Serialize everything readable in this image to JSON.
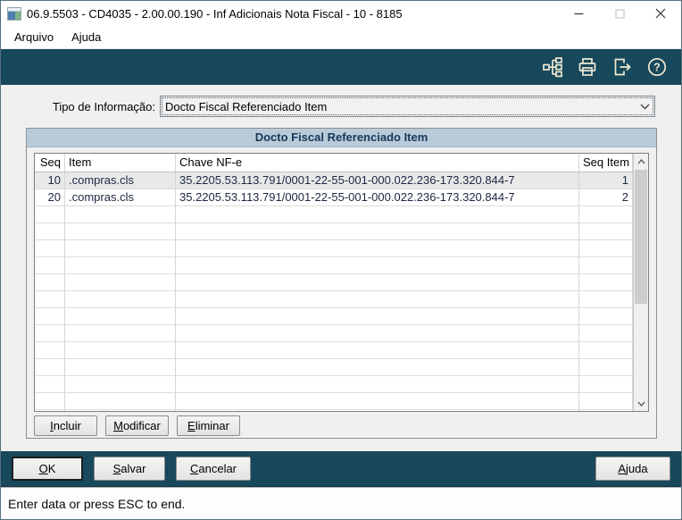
{
  "window": {
    "title": "06.9.5503 - CD4035 - 2.00.00.190 - Inf Adicionais Nota Fiscal - 10 - 8185",
    "controls": [
      {
        "name": "minimize",
        "disabled": false
      },
      {
        "name": "maximize",
        "disabled": true
      },
      {
        "name": "close",
        "disabled": false
      }
    ]
  },
  "menu": {
    "items": [
      {
        "label": "Arquivo"
      },
      {
        "label": "Ajuda"
      }
    ]
  },
  "toolbar": {
    "icons": [
      {
        "name": "program-tree-icon"
      },
      {
        "name": "print-icon"
      },
      {
        "name": "exit-icon"
      },
      {
        "name": "help-icon"
      }
    ]
  },
  "form": {
    "tipo_label": "Tipo de Informação:",
    "tipo_value": "Docto Fiscal Referenciado Item",
    "group_title": "Docto Fiscal Referenciado Item",
    "table": {
      "columns": [
        "Seq",
        "Item",
        "Chave NF-e",
        "Seq Item"
      ],
      "rows": [
        {
          "seq": "10",
          "item": ".compras.cls",
          "chave": "35.2205.53.113.791/0001-22-55-001-000.022.236-173.320.844-7",
          "seq_item": "1"
        },
        {
          "seq": "20",
          "item": ".compras.cls",
          "chave": "35.2205.53.113.791/0001-22-55-001-000.022.236-173.320.844-7",
          "seq_item": "2"
        }
      ],
      "selected_row_index": 0,
      "visible_row_count": 15
    },
    "actions": [
      {
        "label": "Incluir",
        "accel_index": 0
      },
      {
        "label": "Modificar",
        "accel_index": 0
      },
      {
        "label": "Eliminar",
        "accel_index": 0
      }
    ]
  },
  "footer": {
    "left_buttons": [
      {
        "label": "OK",
        "accel_index": 0,
        "default": true,
        "key": "ok"
      },
      {
        "label": "Salvar",
        "accel_index": 0,
        "default": false,
        "key": "salvar"
      },
      {
        "label": "Cancelar",
        "accel_index": 0,
        "default": false,
        "key": "cancelar"
      }
    ],
    "right_buttons": [
      {
        "label": "Ajuda",
        "accel_index": 0,
        "default": false,
        "key": "ajuda"
      }
    ]
  },
  "statusbar": {
    "text": "Enter data or press ESC to end."
  },
  "colors": {
    "teal": "#17485C",
    "toolbar_icon": "#EFE9D2",
    "group_header_bg": "#B9CBD8",
    "group_header_text": "#17375A",
    "selected_row_bg": "#E9E9E9",
    "cell_text": "#1C2742"
  }
}
